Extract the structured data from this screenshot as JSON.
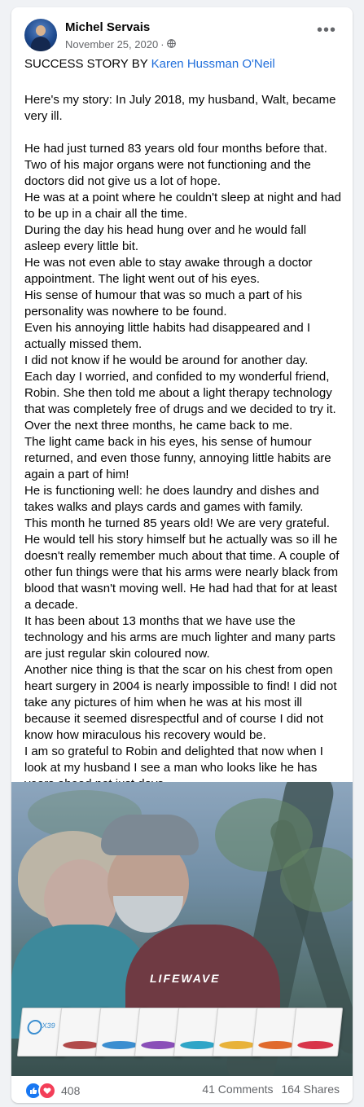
{
  "post": {
    "author": "Michel Servais",
    "date": "November 25, 2020",
    "separator": "·",
    "privacy_icon": "globe-icon",
    "more_icon": "more-options-icon",
    "more_label": "•••",
    "headline_prefix": "SUCCESS STORY BY ",
    "headline_link": "Karen Hussman O'Neil",
    "paragraphs": [
      "Here's my story: In July 2018, my husband, Walt, became very ill.",
      "",
      "He had just turned 83 years old four months before that. Two of his major organs were not functioning and the doctors did not give us a lot of hope.",
      "He was at a point where he couldn't sleep at night and had to be up in a chair all the time.",
      "During the day his head hung over and he would fall asleep every little bit.",
      "He was not even able to stay awake through a doctor appointment. The light went out of his eyes.",
      "His sense of humour that was so much a part of his personality was nowhere to be found.",
      "Even his annoying little habits had disappeared and I actually missed them.",
      "I did not know if he would be around for another day.",
      "Each day I worried, and confided to my wonderful friend, Robin. She then told me about a light therapy technology that was completely free of drugs and we decided to try it.",
      "Over the next three months, he came back to me.",
      "The light came back in his eyes, his sense of humour returned, and even those funny, annoying little habits are again a part of him!",
      "He is functioning well: he does laundry and dishes and takes walks and plays cards and games with family.",
      "This month he turned 85 years old! We are very grateful.",
      "He would tell his story himself but he actually was so ill he doesn't really remember much about that time. A couple of other fun things were that his arms were nearly black from blood that wasn't moving well. He had had that for at least a decade.",
      "It has been about 13 months that we have use the technology and his arms are much lighter and many parts are just regular skin coloured now.",
      "Another nice thing is that the scar on his chest from open heart surgery in 2004 is nearly impossible to find! I did not take any pictures of him when he was at his most ill because it seemed disrespectful and of course I did not know how miraculous his recovery would be.",
      "I am so grateful to Robin and delighted that now when I look at my husband I see a man who looks like he has years ahead not just days."
    ],
    "image": {
      "brand": "LIFEWAVE",
      "pack_label": "X39"
    },
    "reactions": {
      "icons": [
        "like-icon",
        "love-icon"
      ],
      "count": "408",
      "comments": "41 Comments",
      "shares": "164 Shares"
    },
    "colors": {
      "link": "#216fdb",
      "like": "#1877f2",
      "love": "#f33e58",
      "meta": "#65676b"
    }
  }
}
